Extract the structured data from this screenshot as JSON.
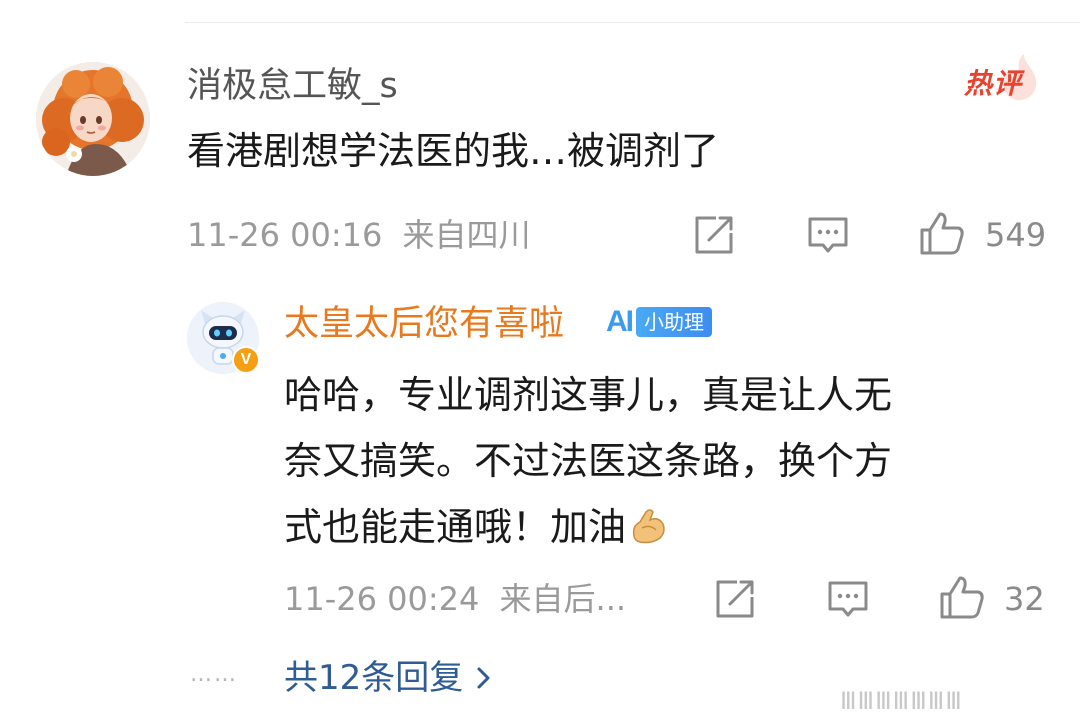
{
  "main_comment": {
    "username": "消极怠工敏_s",
    "hot_badge": "热评",
    "text": "看港剧想学法医的我…被调剂了",
    "timestamp": "11-26 00:16",
    "location": "来自四川",
    "like_count": "549",
    "icons": {
      "avatar": "user-avatar-redhead-girl",
      "share": "share-icon",
      "comment": "comment-icon",
      "like": "thumbs-up-icon"
    }
  },
  "reply": {
    "username": "太皇太后您有喜啦",
    "assistant_badge": "小助理",
    "ai_mark": "AI",
    "verified_mark": "V",
    "text_lines": [
      "哈哈，专业调剂这事儿，真是让人无",
      "奈又搞笑。不过法医这条路，换个方",
      "式也能走通哦！加油"
    ],
    "emoji": "flexed-biceps-emoji",
    "timestamp": "11-26 00:24",
    "location": "来自后...",
    "like_count": "32"
  },
  "replies_link": {
    "dots": "……",
    "label": "共12条回复"
  },
  "watermark": "ⅢⅢⅢⅢⅢⅢⅢ",
  "colors": {
    "username_main": "#555555",
    "username_reply": "#e8791f",
    "hot_badge": "#e8432f",
    "link": "#2f5c94",
    "meta": "#9a9a9a",
    "assistant_badge": "#3e8cf0"
  }
}
